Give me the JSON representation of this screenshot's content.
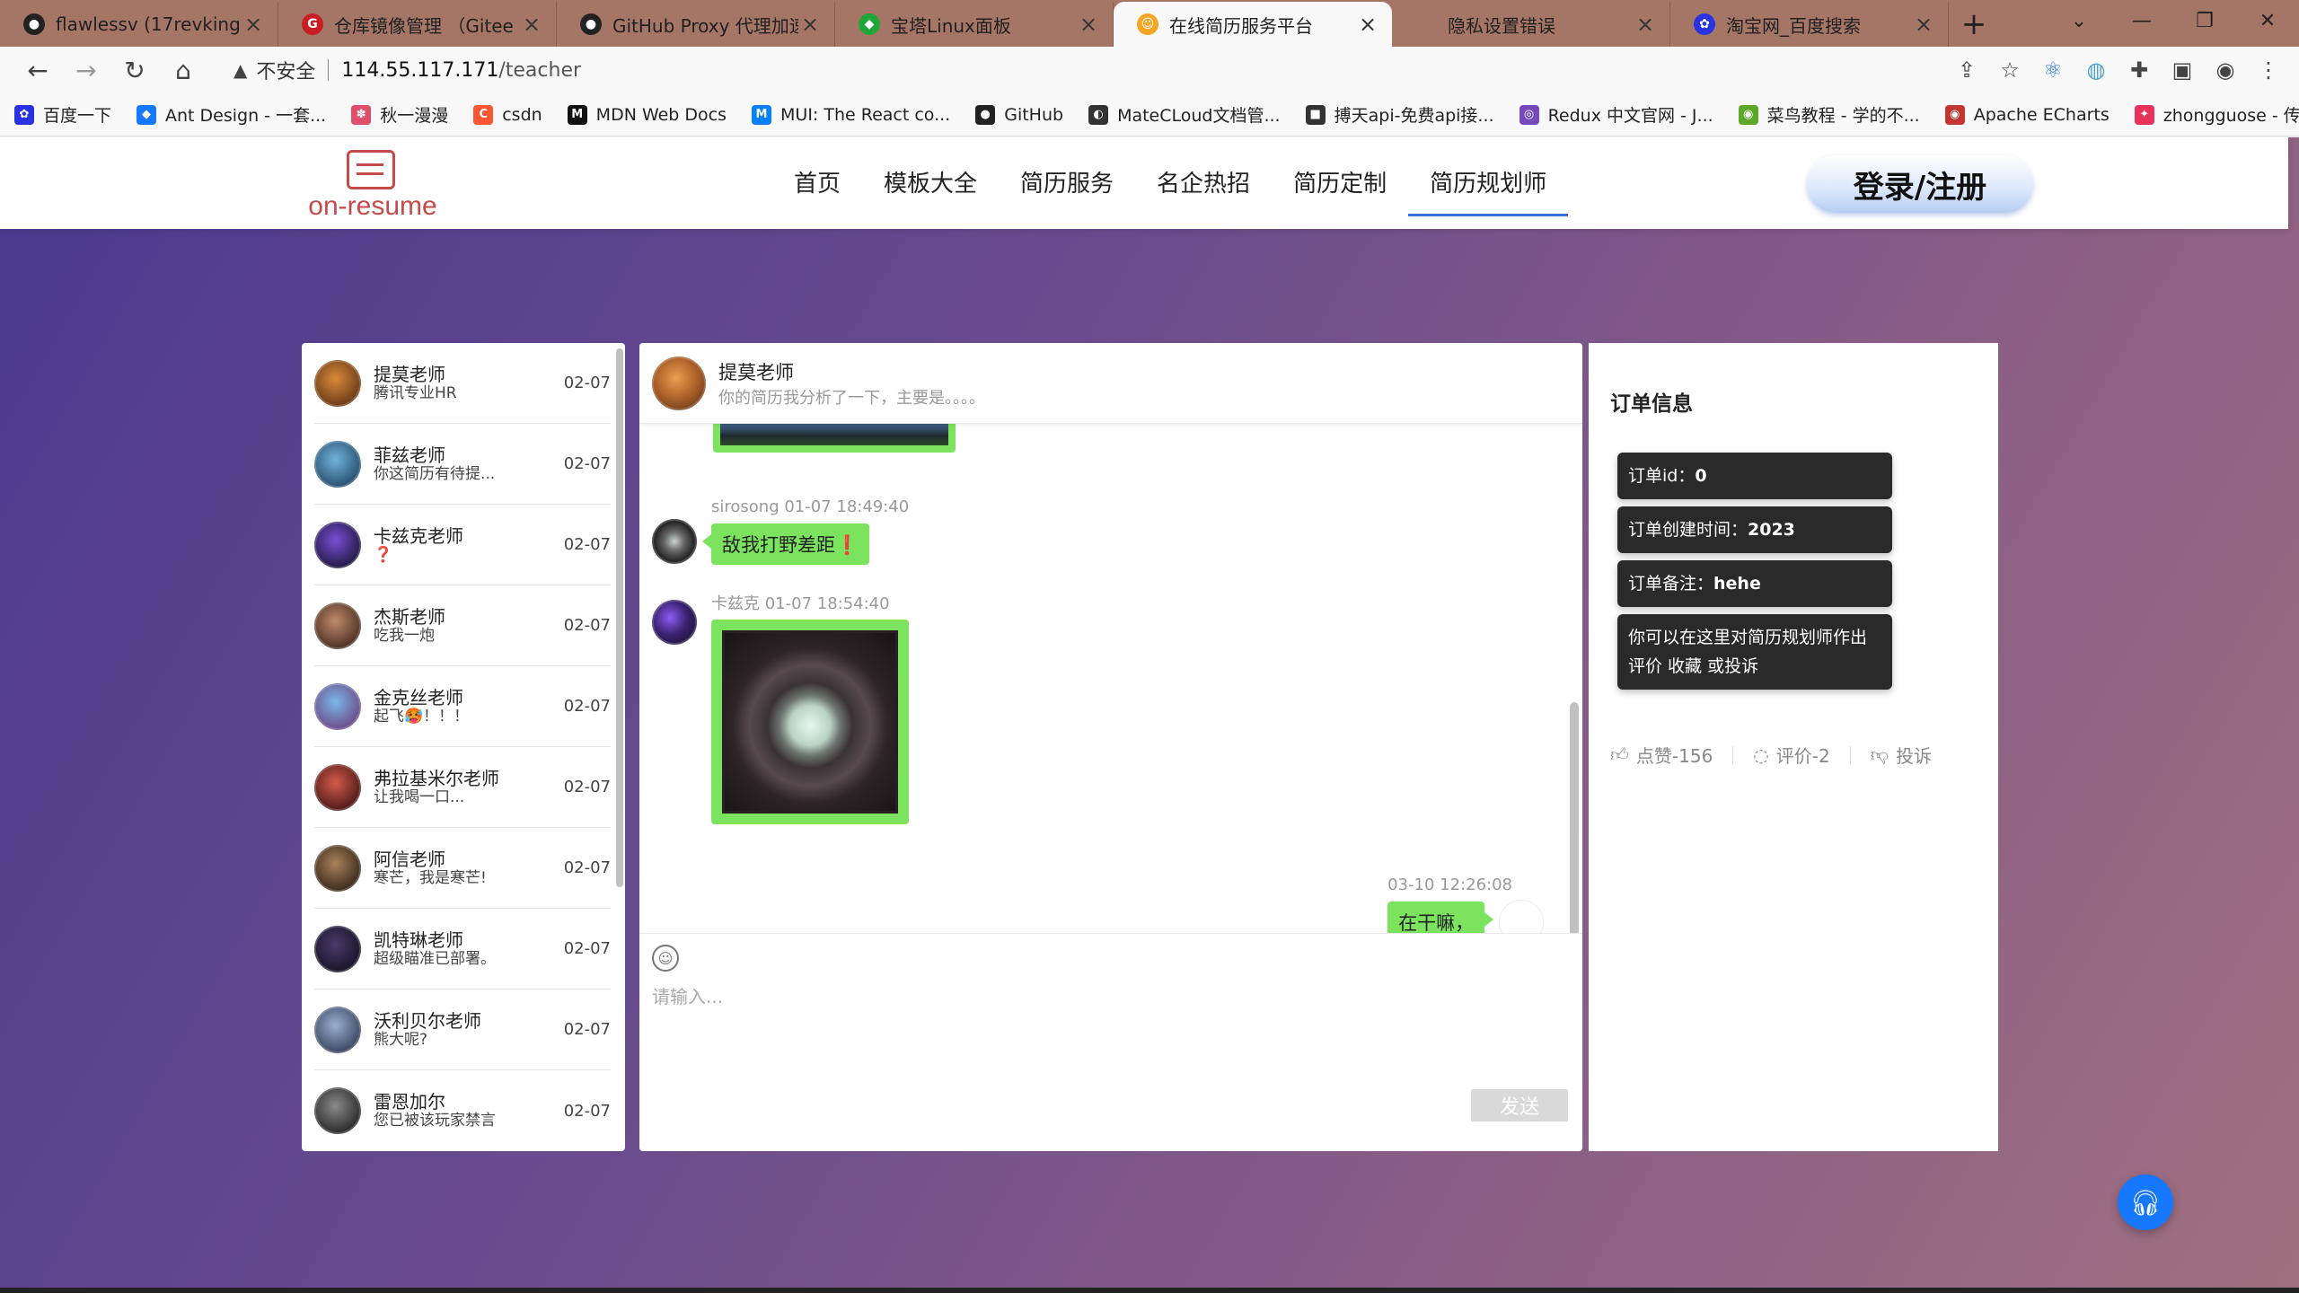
{
  "browser": {
    "tabs": [
      {
        "label": "flawlessv (17revking)",
        "fav": "github-icon",
        "color": "#222222",
        "glyph": "●"
      },
      {
        "label": "仓库镜像管理 （Gitee <",
        "fav": "gitee-icon",
        "color": "#c71d23",
        "glyph": "G"
      },
      {
        "label": "GitHub Proxy 代理加速",
        "fav": "github-icon",
        "color": "#222222",
        "glyph": "●"
      },
      {
        "label": "宝塔Linux面板",
        "fav": "shield-icon",
        "color": "#20a53a",
        "glyph": "◆"
      },
      {
        "label": "在线简历服务平台",
        "fav": "smile-icon",
        "color": "#f5a623",
        "glyph": "☺"
      },
      {
        "label": "隐私设置错误",
        "fav": "blank-icon",
        "color": "#a57666",
        "glyph": ""
      },
      {
        "label": "淘宝网_百度搜索",
        "fav": "baidu-icon",
        "color": "#2932e1",
        "glyph": "✿"
      }
    ],
    "active_tab": 4,
    "url_insecure": "不安全",
    "url_host": "114.55.117.171",
    "url_path": "/teacher",
    "bookmarks": [
      {
        "label": "百度一下",
        "color": "#2932e1",
        "glyph": "✿"
      },
      {
        "label": "Ant Design - 一套...",
        "color": "#1677ff",
        "glyph": "◆"
      },
      {
        "label": "秋一漫漫",
        "color": "#e04e6b",
        "glyph": "✽"
      },
      {
        "label": "csdn",
        "color": "#fc5531",
        "glyph": "C"
      },
      {
        "label": "MDN Web Docs",
        "color": "#111111",
        "glyph": "M"
      },
      {
        "label": "MUI: The React co...",
        "color": "#007fff",
        "glyph": "M"
      },
      {
        "label": "GitHub",
        "color": "#222222",
        "glyph": "●"
      },
      {
        "label": "MateCLoud文档管...",
        "color": "#333333",
        "glyph": "◐"
      },
      {
        "label": "搏天api-免费api接...",
        "color": "#333333",
        "glyph": "■"
      },
      {
        "label": "Redux 中文官网 - J...",
        "color": "#764abc",
        "glyph": "◎"
      },
      {
        "label": "菜鸟教程 - 学的不...",
        "color": "#5ea828",
        "glyph": "◉"
      },
      {
        "label": "Apache ECharts",
        "color": "#c23531",
        "glyph": "◉"
      },
      {
        "label": "zhongguose - 传...",
        "color": "#e8315b",
        "glyph": "✦"
      }
    ]
  },
  "site": {
    "logo_text": "on-resume",
    "nav": [
      "首页",
      "模板大全",
      "简历服务",
      "名企热招",
      "简历定制",
      "简历规划师"
    ],
    "active_nav": 5,
    "login": "登录/注册"
  },
  "contacts": [
    {
      "name": "提莫老师",
      "msg": "腾讯专业HR",
      "date": "02-07",
      "c1": "#d98a3a",
      "c2": "#5a2e12"
    },
    {
      "name": "菲兹老师",
      "msg": "你这简历有待提...",
      "date": "02-07",
      "c1": "#6fb3d9",
      "c2": "#1d3f5e"
    },
    {
      "name": "卡兹克老师",
      "msg": "❓",
      "date": "02-07",
      "c1": "#7a4fd6",
      "c2": "#14102e"
    },
    {
      "name": "杰斯老师",
      "msg": "吃我一炮",
      "date": "02-07",
      "c1": "#c08a6a",
      "c2": "#3a2218"
    },
    {
      "name": "金克丝老师",
      "msg": "起飞🥵！！！",
      "date": "02-07",
      "c1": "#7ab8e8",
      "c2": "#6a3a7a"
    },
    {
      "name": "弗拉基米尔老师",
      "msg": "让我喝一口...",
      "date": "02-07",
      "c1": "#d25a4a",
      "c2": "#3a1010"
    },
    {
      "name": "阿信老师",
      "msg": "寒芒，我是寒芒!",
      "date": "02-07",
      "c1": "#a8825a",
      "c2": "#2a1c12"
    },
    {
      "name": "凯特琳老师",
      "msg": "超级瞄准已部署。",
      "date": "02-07",
      "c1": "#4a3a6a",
      "c2": "#120e1e"
    },
    {
      "name": "沃利贝尔老师",
      "msg": "熊大呢?",
      "date": "02-07",
      "c1": "#9ab0d0",
      "c2": "#2a3550"
    },
    {
      "name": "雷恩加尔",
      "msg": "您已被该玩家禁言",
      "date": "02-07",
      "c1": "#8a8a8a",
      "c2": "#1a1a1a"
    }
  ],
  "chat": {
    "name": "提莫老师",
    "sub": "你的简历我分析了一下，主要是。。。。",
    "msg1_meta": "sirosong   01-07 18:49:40",
    "msg1_text": "敌我打野差距❗",
    "msg2_meta": "卡兹克   01-07 18:54:40",
    "msg3_meta": "03-10 12:26:08",
    "msg3_text": "在干嘛，",
    "placeholder": "请输入...",
    "send": "发送"
  },
  "order": {
    "title": "订单信息",
    "id_label": "订单id：",
    "id_value": "0",
    "created_label": "订单创建时间：",
    "created_value": "2023",
    "note_label": "订单备注：",
    "note_value": "hehe",
    "hint": "你可以在这里对简历规划师作出评价 收藏 或投诉",
    "like": "点赞-156",
    "comment": "评价-2",
    "report": "投诉"
  }
}
